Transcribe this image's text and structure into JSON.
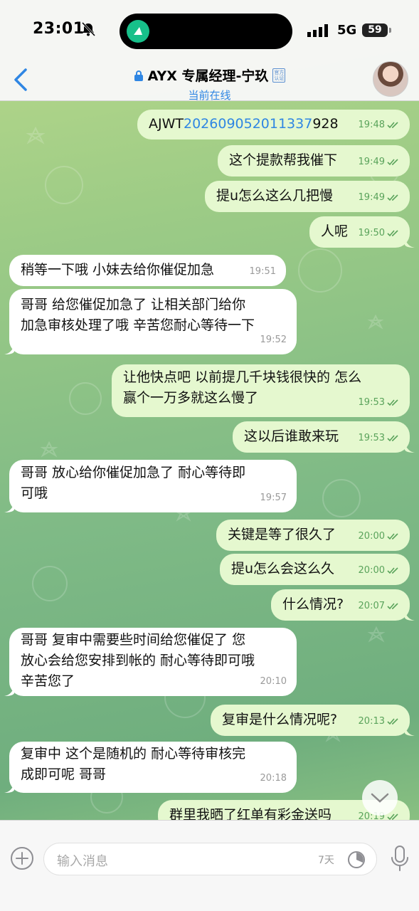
{
  "status_bar": {
    "time": "23:01",
    "network": "5G",
    "battery": "59"
  },
  "header": {
    "title": "AYX 专属经理-宁玖",
    "badge": "官方认证",
    "subtitle": "当前在线"
  },
  "messages": [
    {
      "dir": "out",
      "text_prefix": "AJWT",
      "text_link": "202609052011337",
      "text_suffix": "928",
      "time": "19:48"
    },
    {
      "dir": "out",
      "text": "这个提款帮我催下",
      "time": "19:49"
    },
    {
      "dir": "out",
      "text": "提u怎么这么几把慢",
      "time": "19:49"
    },
    {
      "dir": "out",
      "text": "人呢",
      "time": "19:50"
    },
    {
      "dir": "in",
      "text": "稍等一下哦  小妹去给你催促加急",
      "time": "19:51"
    },
    {
      "dir": "in",
      "text": "哥哥  给您催促加急了   让相关部门给你\n加急审核处理了哦  辛苦您耐心等待一下",
      "time": "19:52"
    },
    {
      "dir": "out",
      "text": "让他快点吧 以前提几千块钱很快的  怎么\n赢个一万多就这么慢了",
      "time": "19:53"
    },
    {
      "dir": "out",
      "text": "这以后谁敢来玩",
      "time": "19:53"
    },
    {
      "dir": "in",
      "text": "哥哥  放心给你催促加急了  耐心等待即\n可哦",
      "time": "19:57"
    },
    {
      "dir": "out",
      "text": "关键是等了很久了",
      "time": "20:00"
    },
    {
      "dir": "out",
      "text": "提u怎么会这么久",
      "time": "20:00"
    },
    {
      "dir": "out",
      "text": "什么情况?",
      "time": "20:07"
    },
    {
      "dir": "in",
      "text": "哥哥  复审中需要些时间给您催促了  您\n放心会给您安排到帐的  耐心等待即可哦\n辛苦您了",
      "time": "20:10"
    },
    {
      "dir": "out",
      "text": "复审是什么情况呢?",
      "time": "20:13"
    },
    {
      "dir": "in",
      "text": "复审中  这个是随机的  耐心等待审核完\n成即可呢  哥哥",
      "time": "20:18"
    },
    {
      "dir": "out",
      "text": "群里我晒了红单有彩金送吗",
      "time": "20:19"
    }
  ],
  "input": {
    "placeholder": "输入消息",
    "timer_label": "7天"
  },
  "icons": {
    "bell": "bell-slash-icon",
    "signal": "signal-bars-icon",
    "back": "chevron-left-icon",
    "lock": "lock-icon",
    "attach": "plus-circle-icon",
    "timer": "timer-icon",
    "mic": "microphone-icon",
    "scroll": "chevron-down-icon",
    "read": "double-check-icon"
  },
  "colors": {
    "accent": "#2f86e3",
    "outgoing_bubble": "#e5f8cf",
    "incoming_bubble": "#ffffff",
    "read_check": "#5aa35b"
  }
}
